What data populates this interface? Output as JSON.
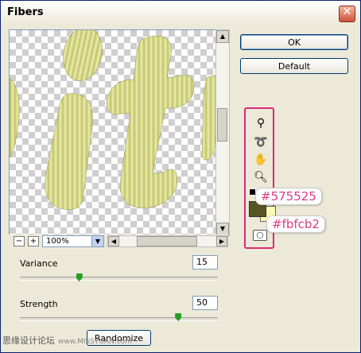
{
  "window": {
    "title": "Fibers"
  },
  "buttons": {
    "ok": "OK",
    "default": "Default",
    "randomize": "Randomize"
  },
  "preview": {
    "zoom": "100%",
    "zoom_in": "+",
    "zoom_out": "−"
  },
  "colors": {
    "foreground": "#575525",
    "background": "#fbfcb2",
    "fiber_color": "#d8d98a",
    "callout_text_color": "#e03a86",
    "tool_highlight": "#d92c77"
  },
  "callouts": {
    "fg": "#575525",
    "bg": "#fbfcb2"
  },
  "tools": [
    "magic-wand-icon",
    "lasso-icon",
    "hand-icon",
    "zoom-icon"
  ],
  "controls": {
    "variance": {
      "label": "Variance",
      "value": "15",
      "level": 0.3
    },
    "strength": {
      "label": "Strength",
      "value": "50",
      "level": 0.8
    }
  },
  "watermark": {
    "text": "思缘设计论坛",
    "url": "www.MISSYUAN.com"
  }
}
